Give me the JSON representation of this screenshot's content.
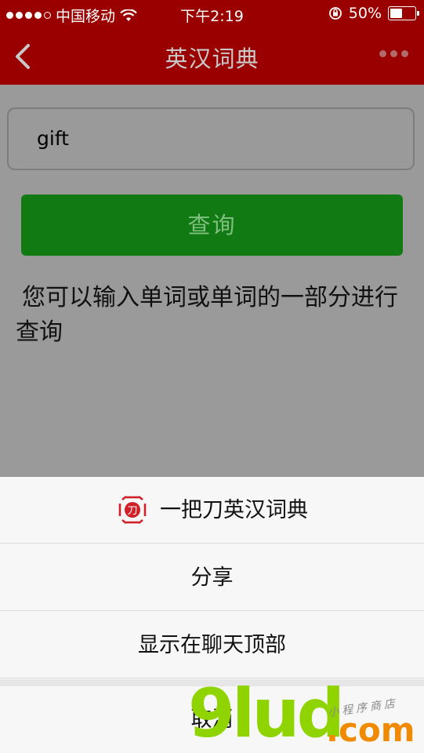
{
  "status_bar": {
    "carrier": "中国移动",
    "time": "下午2:19",
    "battery": "50%"
  },
  "nav": {
    "title": "英汉词典"
  },
  "search": {
    "value": "gift"
  },
  "query_button": {
    "label": "查询"
  },
  "hint": "您可以输入单词或单词的一部分进行查询",
  "action_sheet": {
    "app_name": "一把刀英汉词典",
    "share": "分享",
    "pin_to_top": "显示在聊天顶部",
    "cancel": "取消"
  },
  "watermark": {
    "brand": "9lud",
    "domain": ".com",
    "tagline": "小程序商店"
  },
  "colors": {
    "nav_red": "#9b0000",
    "button_green": "#127a12",
    "watermark_green": "#8fd400",
    "watermark_orange": "#f08a00"
  }
}
